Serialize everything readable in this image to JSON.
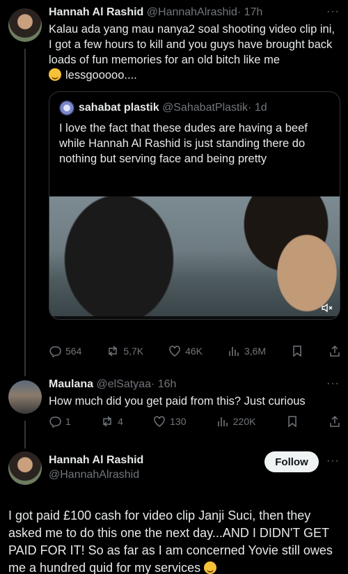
{
  "tweet1": {
    "name": "Hannah Al Rashid",
    "handle": "@HannahAlrashid",
    "time": "· 17h",
    "text": "Kalau ada yang mau nanya2 soal shooting video clip ini, I got a few hours to kill and you guys have brought back loads of fun memories for an old bitch like me",
    "text_end": "lessgooooo....",
    "quote": {
      "name": "sahabat plastik",
      "handle": "@SahabatPlastik",
      "time": "· 1d",
      "text": "I love the fact that these dudes are having a beef while Hannah Al Rashid is just standing there do nothing but serving face and being pretty"
    },
    "actions": {
      "replies": "564",
      "reposts": "5,7K",
      "likes": "46K",
      "views": "3,6M"
    }
  },
  "tweet2": {
    "name": "Maulana",
    "handle": "@elSatyaa",
    "time": "· 16h",
    "text": "How much did you get paid from this? Just curious",
    "actions": {
      "replies": "1",
      "reposts": "4",
      "likes": "130",
      "views": "220K"
    }
  },
  "tweet3": {
    "name": "Hannah Al Rashid",
    "handle": "@HannahAlrashid",
    "follow_label": "Follow",
    "text": "I got paid £100 cash for video clip Janji Suci, then they asked me to do this one the next day...AND I DIDN'T GET PAID FOR IT! So as far as I am concerned Yovie still owes me a hundred quid for my services"
  },
  "icons": [
    "more-icon",
    "reply-icon",
    "repost-icon",
    "like-icon",
    "views-icon",
    "bookmark-icon",
    "share-icon",
    "mute-icon"
  ]
}
